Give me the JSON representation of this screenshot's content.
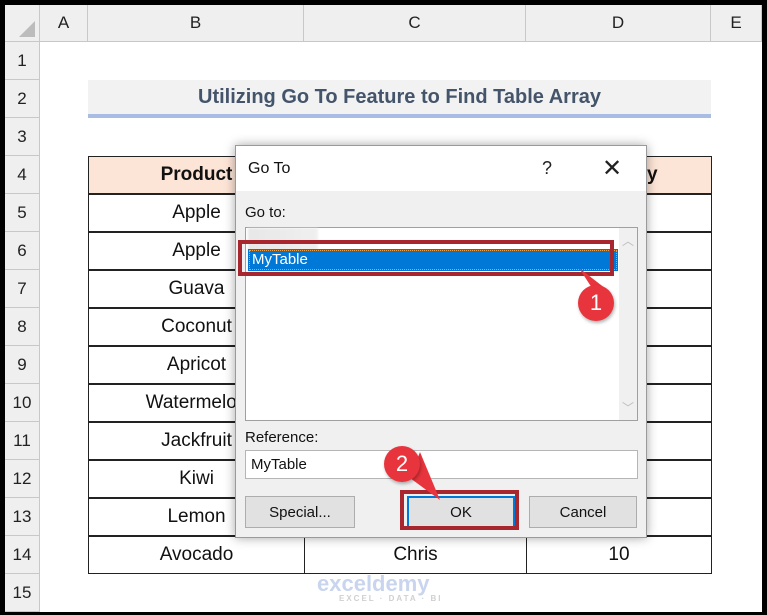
{
  "columns": [
    "A",
    "B",
    "C",
    "D",
    "E"
  ],
  "rows": [
    "1",
    "2",
    "3",
    "4",
    "5",
    "6",
    "7",
    "8",
    "9",
    "10",
    "11",
    "12",
    "13",
    "14",
    "15"
  ],
  "title": "Utilizing Go To Feature to Find Table Array",
  "table": {
    "headers": [
      "Product",
      "",
      "Quantity"
    ],
    "products": [
      "Apple",
      "Apple",
      "Guava",
      "Coconut",
      "Apricot",
      "Watermelon",
      "Jackfruit",
      "Kiwi",
      "Lemon",
      "Avocado"
    ],
    "last_row": {
      "c": "Chris",
      "d": "10"
    }
  },
  "dialog": {
    "title": "Go To",
    "help": "?",
    "close": "✕",
    "goto_label": "Go to:",
    "items": [
      "MyTable"
    ],
    "reference_label": "Reference:",
    "reference_value": "MyTable",
    "special": "Special...",
    "ok": "OK",
    "cancel": "Cancel"
  },
  "callouts": [
    "1",
    "2"
  ],
  "watermark": {
    "name": "exceldemy",
    "tagline": "EXCEL · DATA · BI"
  },
  "colors": {
    "accent_red": "#a8262e",
    "callout": "#e8343c",
    "selection": "#0078d7",
    "header_fill": "#fce4d6"
  }
}
